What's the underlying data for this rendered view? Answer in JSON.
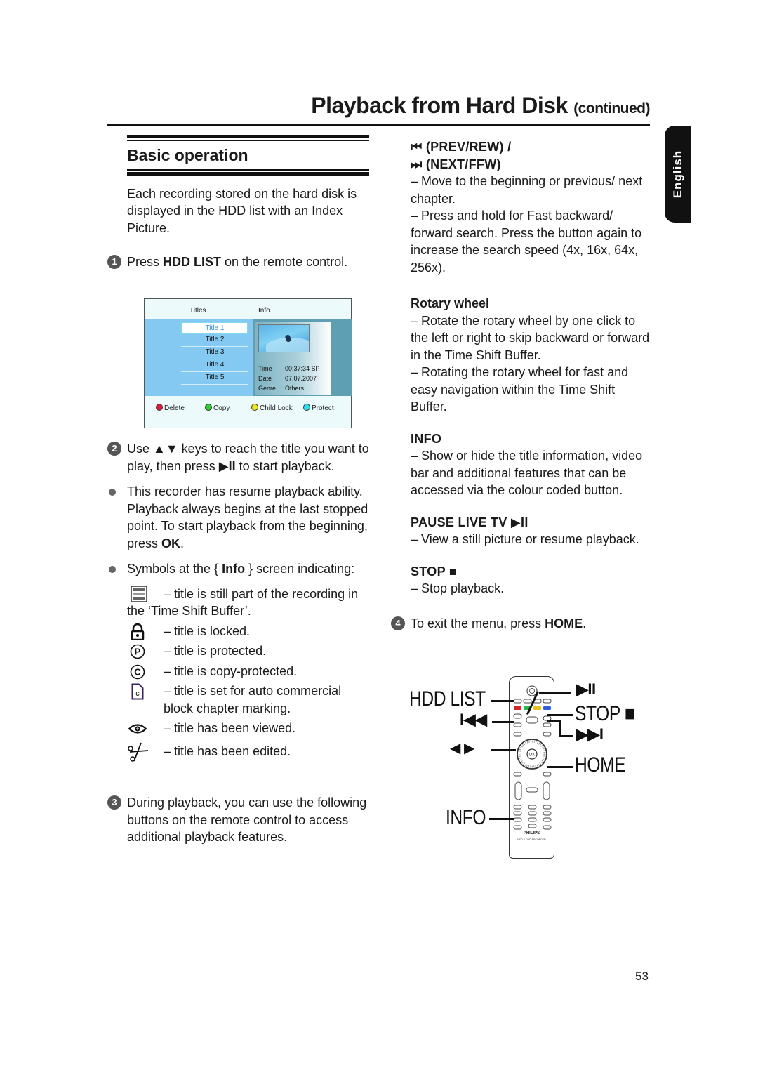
{
  "header": {
    "title": "Playback from Hard Disk",
    "title_suffix": "(continued)",
    "language_tab": "English"
  },
  "left": {
    "section_title": "Basic operation",
    "intro": "Each recording stored on the hard disk is displayed in the HDD list with an Index Picture.",
    "step1": {
      "num": "1",
      "pre": "Press ",
      "bold": "HDD LIST",
      "post": " on the remote control."
    },
    "hdd_screen": {
      "col_titles": "Titles",
      "col_info": "Info",
      "titles": [
        "Title 1",
        "Title 2",
        "Title 3",
        "Title 4",
        "Title 5"
      ],
      "selected_index": 0,
      "meta": [
        {
          "label": "Time",
          "value": "00:37:34  SP"
        },
        {
          "label": "Date",
          "value": "07.07.2007"
        },
        {
          "label": "Genre",
          "value": "Others"
        }
      ],
      "buttons": [
        {
          "label": "Delete",
          "color": "#e8173a"
        },
        {
          "label": "Copy",
          "color": "#2ecc2e"
        },
        {
          "label": "Child Lock",
          "color": "#f4e41a"
        },
        {
          "label": "Protect",
          "color": "#2fe0f0"
        }
      ]
    },
    "step2": {
      "num": "2",
      "pre": "Use ",
      "keys": "▲▼",
      "mid": " keys to reach the title you want to play, then press ",
      "play": "▶II",
      "post": " to start playback."
    },
    "bullet1": {
      "pre": "This recorder has resume playback ability.  Playback always begins at the last stopped point.  To start playback from the beginning, press ",
      "bold": "OK",
      "post": "."
    },
    "bullet2": {
      "pre": "Symbols at the { ",
      "bold": "Info",
      "post": " } screen indicating:"
    },
    "symbols": [
      {
        "icon": "time-shift-buffer-icon",
        "text": "– title is still part of the recording in the ‘Time Shift Buffer’."
      },
      {
        "icon": "lock-icon",
        "text": "– title is locked."
      },
      {
        "icon": "protected-p-icon",
        "text": "– title is protected."
      },
      {
        "icon": "copyright-c-icon",
        "text": "– title is copy-protected."
      },
      {
        "icon": "commercial-chapter-icon",
        "text": "– title is set for auto commercial block chapter marking."
      },
      {
        "icon": "eye-icon",
        "text": "– title has been viewed."
      },
      {
        "icon": "scissors-icon",
        "text": "– title has been edited."
      }
    ],
    "step3": {
      "num": "3",
      "text": "During playback, you can use the following buttons on the remote control to access additional playback features."
    }
  },
  "right": {
    "prev_next": {
      "head1_icon": "⏮",
      "head1": "(PREV/REW) /",
      "head2_icon": "⏭",
      "head2": "(NEXT/FFW)",
      "items": [
        "–   Move to the beginning or previous/ next chapter.",
        "–   Press and hold for Fast backward/ forward search.  Press the button again to increase the search speed (4x, 16x, 64x, 256x)."
      ]
    },
    "rotary": {
      "head": "Rotary wheel",
      "items": [
        "–   Rotate the rotary wheel by one click to the left or right to skip backward or forward in the Time Shift Buffer.",
        "–   Rotating the rotary wheel for fast and easy navigation within the Time Shift Buffer."
      ]
    },
    "info": {
      "head": "INFO",
      "text": "–   Show or hide the title information, video bar and additional features that can be accessed via the colour coded button."
    },
    "pause": {
      "head": "PAUSE LIVE TV",
      "head_icon": "▶II",
      "text": "–   View a still picture or resume playback."
    },
    "stop": {
      "head": "STOP",
      "head_icon": "■",
      "text": "–   Stop playback."
    },
    "step4": {
      "num": "4",
      "pre": "To exit the menu, press ",
      "bold": "HOME",
      "post": "."
    }
  },
  "remote_figure": {
    "labels": {
      "hdd_list": "HDD LIST",
      "play_pause": "▶II",
      "stop": "STOP ■",
      "prev": "I◀◀",
      "next": "▶▶I",
      "left_right": "◀  ▶",
      "home": "HOME",
      "info": "INFO"
    },
    "brand": "PHILIPS",
    "model": "HDD & DVD RECORDER",
    "color_keys": [
      "#d62a2a",
      "#2eb84a",
      "#e8c21c",
      "#2f5fd8"
    ]
  },
  "footer": {
    "page_number": "53"
  }
}
